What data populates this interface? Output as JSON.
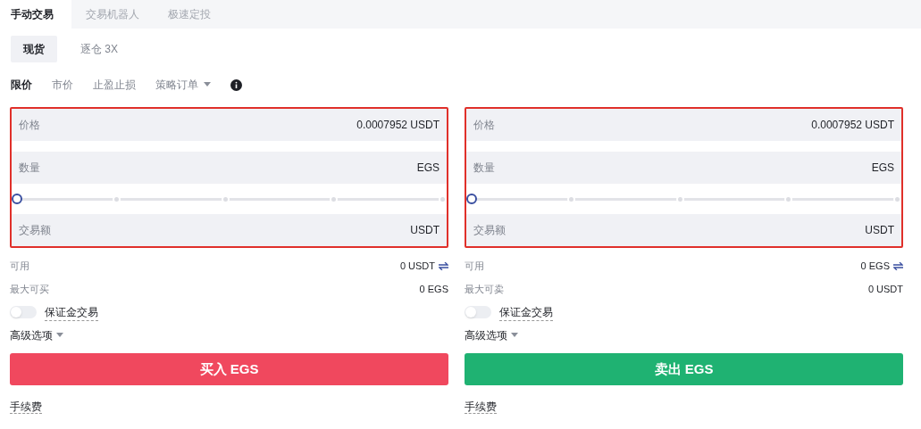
{
  "top_tabs": [
    {
      "label": "手动交易",
      "selected": true
    },
    {
      "label": "交易机器人",
      "selected": false
    },
    {
      "label": "极速定投",
      "selected": false
    }
  ],
  "account_tabs": [
    {
      "label": "现货",
      "selected": true
    },
    {
      "label": "逐仓 3X",
      "selected": false
    }
  ],
  "order_types": [
    {
      "label": "限价",
      "selected": true,
      "kind": "plain"
    },
    {
      "label": "市价",
      "selected": false,
      "kind": "plain"
    },
    {
      "label": "止盈止损",
      "selected": false,
      "kind": "plain"
    },
    {
      "label": "策略订单",
      "selected": false,
      "kind": "dropdown"
    }
  ],
  "panels": [
    {
      "kind": "buy",
      "fields": [
        {
          "label": "价格",
          "value": "0.0007952 USDT"
        },
        {
          "label": "数量",
          "value": "EGS"
        }
      ],
      "slider": {
        "level": 0
      },
      "total": {
        "label": "交易额",
        "value": "USDT"
      },
      "available": {
        "label": "可用",
        "value": "0 USDT"
      },
      "max": {
        "label": "最大可买",
        "value": "0 EGS"
      },
      "margin": {
        "label": "保证金交易",
        "on": false
      },
      "advanced": "高级选项",
      "button": "买入 EGS",
      "fee": "手续费"
    },
    {
      "kind": "sell",
      "fields": [
        {
          "label": "价格",
          "value": "0.0007952 USDT"
        },
        {
          "label": "数量",
          "value": "EGS"
        }
      ],
      "slider": {
        "level": 0
      },
      "total": {
        "label": "交易额",
        "value": "USDT"
      },
      "available": {
        "label": "可用",
        "value": "0 EGS"
      },
      "max": {
        "label": "最大可卖",
        "value": "0 USDT"
      },
      "margin": {
        "label": "保证金交易",
        "on": false
      },
      "advanced": "高级选项",
      "button": "卖出 EGS",
      "fee": "手续费"
    }
  ]
}
